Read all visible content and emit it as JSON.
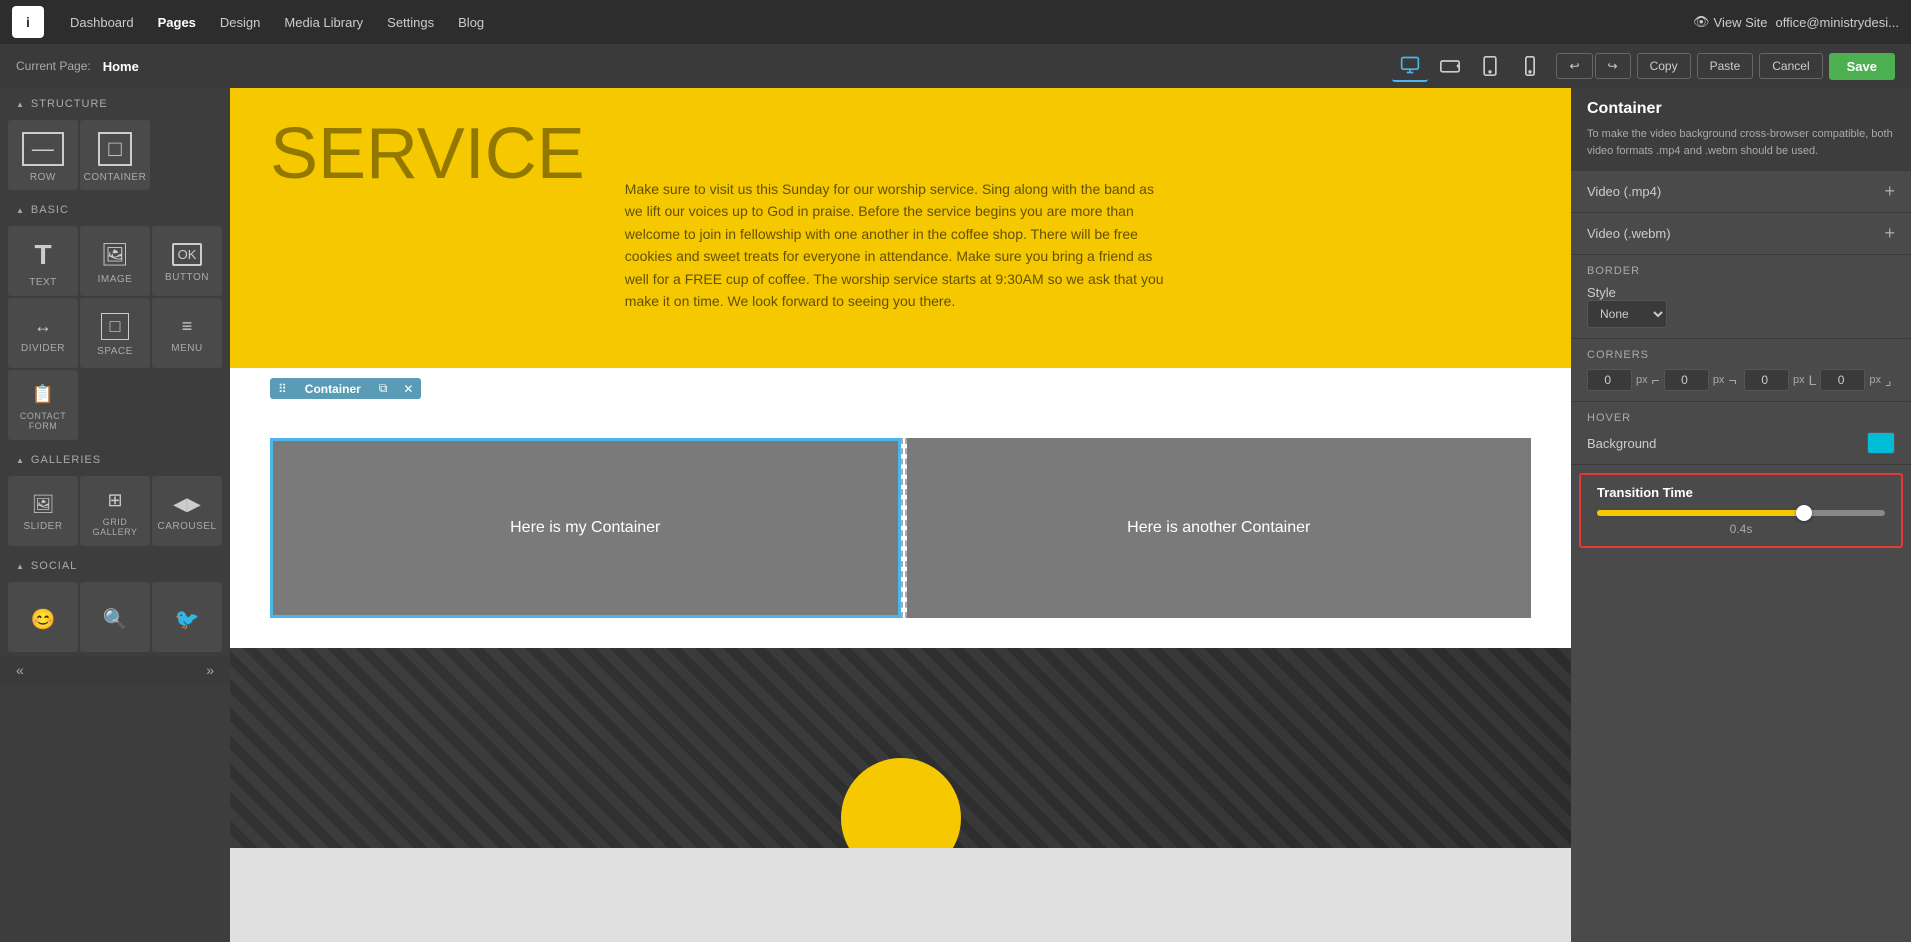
{
  "nav": {
    "logo": "i",
    "links": [
      "Dashboard",
      "Pages",
      "Design",
      "Media Library",
      "Settings",
      "Blog"
    ],
    "active_link": "Pages",
    "view_site": "View Site",
    "user_email": "office@ministrydesi..."
  },
  "toolbar": {
    "current_page_label": "Current Page:",
    "current_page_name": "Home",
    "undo": "↩",
    "redo": "↪",
    "copy_label": "Copy",
    "paste_label": "Paste",
    "cancel_label": "Cancel",
    "save_label": "Save"
  },
  "widgets": {
    "structure_label": "STRUCTURE",
    "basic_label": "BASIC",
    "galleries_label": "GALLERIES",
    "social_label": "SOCIAL",
    "structure_items": [
      {
        "label": "ROW",
        "icon": "▬"
      },
      {
        "label": "CONTAINER",
        "icon": "▭"
      }
    ],
    "basic_items": [
      {
        "label": "TEXT",
        "icon": "T"
      },
      {
        "label": "IMAGE",
        "icon": "🖼"
      },
      {
        "label": "BUTTON",
        "icon": "OK"
      },
      {
        "label": "DIVIDER",
        "icon": "↔"
      },
      {
        "label": "SPACE",
        "icon": "▭"
      },
      {
        "label": "MENU",
        "icon": "≡"
      },
      {
        "label": "CONTACT FORM",
        "icon": "📋"
      }
    ],
    "galleries_items": [
      {
        "label": "SLIDER",
        "icon": "🖼"
      },
      {
        "label": "GRID GALLERY",
        "icon": "⊞"
      },
      {
        "label": "CAROUSEL",
        "icon": "◀▶"
      }
    ]
  },
  "canvas": {
    "yellow_title": "SERVICE",
    "yellow_text": "Make sure to visit us this Sunday for our worship service. Sing along with the band as we lift our voices up to God in praise. Before the service begins you are more than welcome to join in fellowship with one another in the coffee shop. There will be free cookies and sweet treats for everyone in attendance. Make sure you bring a friend as well for a FREE cup of coffee. The worship service starts at 9:30AM so we ask that you make it on time. We look forward to seeing you there.",
    "container_toolbar_label": "Container",
    "container1_text": "Here is my Container",
    "container2_text": "Here is another Container"
  },
  "right_panel": {
    "title": "Container",
    "description": "To make the video background cross-browser compatible, both video formats .mp4 and .webm should be used.",
    "video_mp4_label": "Video (.mp4)",
    "video_webm_label": "Video (.webm)",
    "border_label": "BORDER",
    "style_label": "Style",
    "style_option": "None",
    "corners_label": "CORNERS",
    "corner_tl": "0",
    "corner_tr": "0",
    "corner_bl": "0",
    "corner_br": "0",
    "corner_unit": "px",
    "hover_label": "HOVER",
    "background_label": "Background",
    "hover_color": "#00bcd4",
    "transition_label": "Transition Time",
    "transition_value": "0.4s",
    "slider_percent": 72
  }
}
